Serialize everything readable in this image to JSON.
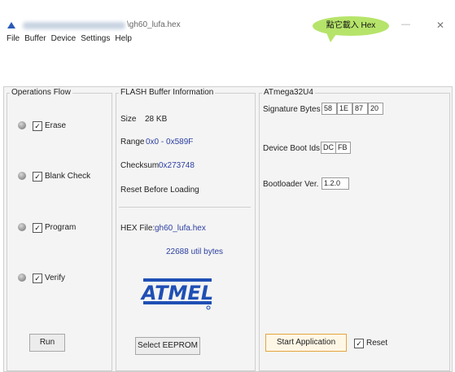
{
  "window": {
    "title_suffix": "\\gh60_lufa.hex"
  },
  "menu": [
    "File",
    "Buffer",
    "Device",
    "Settings",
    "Help"
  ],
  "callout": "點它載入 Hex",
  "operations": {
    "title": "Operations Flow",
    "steps": [
      {
        "label": "Erase",
        "checked": true
      },
      {
        "label": "Blank Check",
        "checked": true
      },
      {
        "label": "Program",
        "checked": true
      },
      {
        "label": "Verify",
        "checked": true
      }
    ],
    "run_label": "Run"
  },
  "flash": {
    "title": "FLASH Buffer Information",
    "size_label": "Size",
    "size_value": "28 KB",
    "range_label": "Range",
    "range_value": "0x0 - 0x589F",
    "checksum_label": "Checksum",
    "checksum_value": "0x273748",
    "reset_label": "Reset Before Loading",
    "hex_label": "HEX File:",
    "hex_value": "gh60_lufa.hex",
    "bytes_value": "22688 util bytes",
    "logo_text": "ATMEL",
    "eeprom_label": "Select EEPROM"
  },
  "device": {
    "title": "ATmega32U4",
    "signature_label": "Signature Bytes",
    "signature": [
      "58",
      "1E",
      "87",
      "20"
    ],
    "bootids_label": "Device Boot Ids",
    "bootids": [
      "DC",
      "FB"
    ],
    "bootloader_label": "Bootloader Ver.",
    "bootloader_value": "1.2.0",
    "start_label": "Start Application",
    "reset_label": "Reset",
    "reset_checked": true
  },
  "colors": {
    "value_blue": "#2c3fa0",
    "accent_orange": "#e5a43e",
    "callout_green": "#b6e46a",
    "atmel_blue": "#1f4fb4"
  }
}
